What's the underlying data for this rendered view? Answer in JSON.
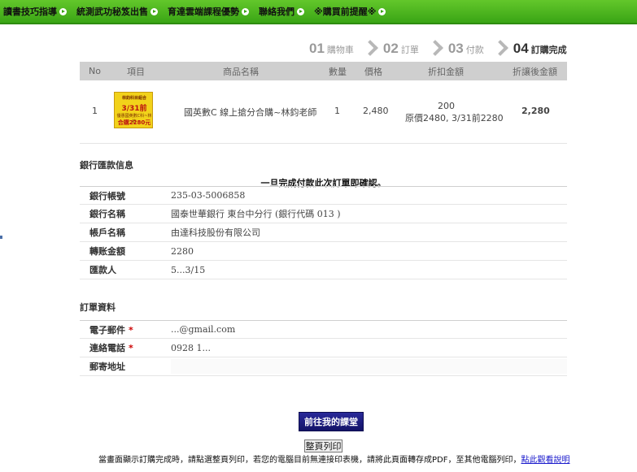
{
  "nav": {
    "items": [
      {
        "label": "讀書技巧指導"
      },
      {
        "label": "統測武功秘笈出售"
      },
      {
        "label": "育達雲端課程優勢"
      },
      {
        "label": "聯絡我們"
      },
      {
        "label": "※購買前提醒※"
      }
    ]
  },
  "steps": [
    {
      "num": "01",
      "label": "購物車"
    },
    {
      "num": "02",
      "label": "訂單"
    },
    {
      "num": "03",
      "label": "付款"
    },
    {
      "num": "04",
      "label": "訂購完成"
    }
  ],
  "order": {
    "headers": {
      "no": "No",
      "item": "項目",
      "name": "商品名稱",
      "qty": "數量",
      "price": "價格",
      "discount": "折扣金額",
      "final": "折讓後金額"
    },
    "row": {
      "no": "1",
      "name": "國英數C 線上搶分合購~林鈞老師",
      "qty": "1",
      "price": "2,480",
      "discount": "200",
      "discount_note": "原價2480, 3/31前2280",
      "final": "2,280",
      "img_text": {
        "line1": "林鈞科目組合",
        "line2": "3/31前",
        "line3": "優惠國英數C科~林鈞",
        "line4": "合購2280元"
      }
    }
  },
  "bank": {
    "title": "銀行匯款信息",
    "notice": "一旦完成付款此次訂單即確認。",
    "rows": [
      {
        "label": "銀行帳號",
        "value": "235-03-5006858"
      },
      {
        "label": "銀行名稱",
        "value": "國泰世華銀行 東台中分行 (銀行代碼 013 )"
      },
      {
        "label": "帳戶名稱",
        "value": "由達科技股份有限公司"
      },
      {
        "label": "轉账金額",
        "value": "2280"
      },
      {
        "label": "匯款人",
        "value": "5...3/15"
      }
    ]
  },
  "orderinfo": {
    "title": "訂單資料",
    "rows": [
      {
        "label": "電子郵件",
        "value": "...@gmail.com",
        "required": "*"
      },
      {
        "label": "連絡電話",
        "value": "0928 1...",
        "required": "*"
      },
      {
        "label": "郵寄地址",
        "value": ""
      }
    ]
  },
  "actions": {
    "goto_class": "前往我的課堂",
    "print": "整頁列印"
  },
  "footer": {
    "text": "當畫面顯示訂購完成時，請點選整頁列印，若您的電腦目前無連接印表機，請將此頁面轉存成PDF，至其他電腦列印，",
    "link": "點此觀看說明"
  },
  "colors": {
    "nav_green": "#3aa515",
    "button_blue": "#1a1a7a",
    "link_blue": "#1a1acc"
  }
}
